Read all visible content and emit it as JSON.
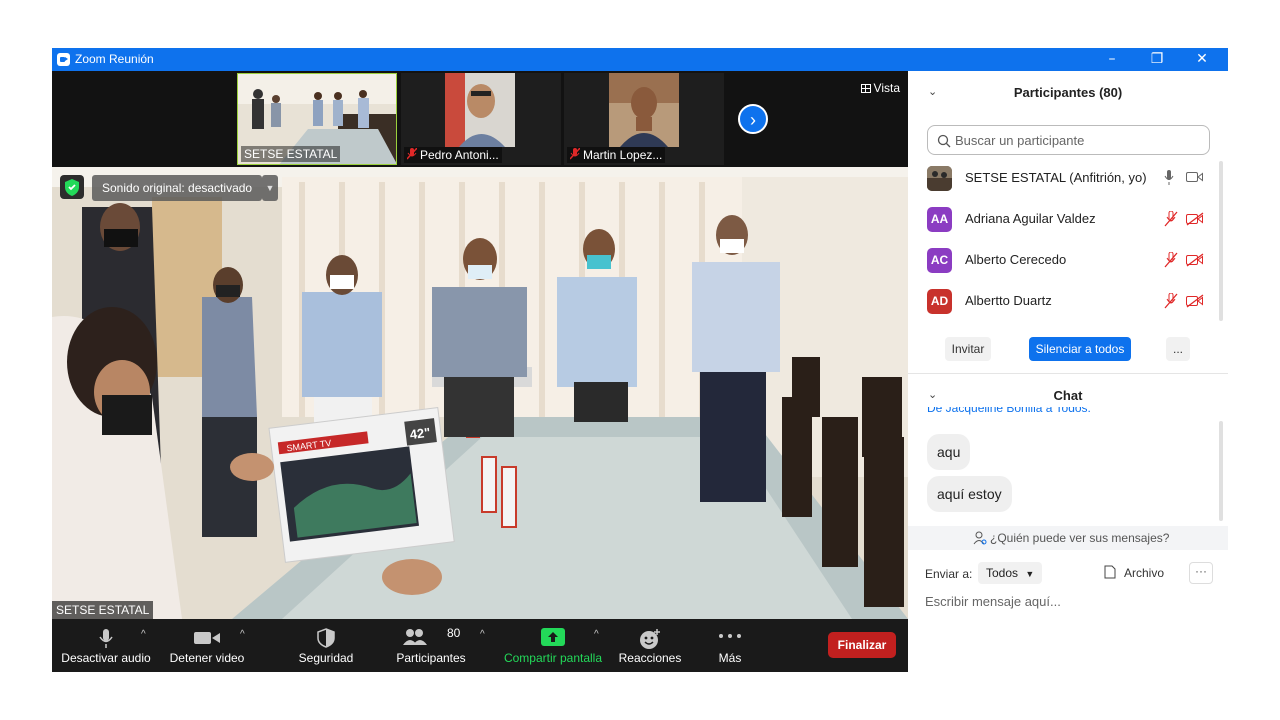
{
  "window": {
    "title": "Zoom Reunión",
    "controls": [
      "–",
      "❐",
      "✕"
    ]
  },
  "strip": {
    "thumbs": [
      {
        "label": "SETSE ESTATAL",
        "muted": false
      },
      {
        "label": "Pedro Antoni...",
        "muted": true
      },
      {
        "label": "Martin Lopez...",
        "muted": true
      }
    ],
    "next_arrow": "›",
    "view_label": "Vista"
  },
  "video": {
    "sound_label": "Sonido original: desactivado",
    "speaker_label": "SETSE ESTATAL",
    "box_text": "SMART TV",
    "box_size": "42\""
  },
  "toolbar": {
    "audio": "Desactivar audio",
    "video": "Detener video",
    "security": "Seguridad",
    "participants": "Participantes",
    "participants_count": "80",
    "share": "Compartir pantalla",
    "reactions": "Reacciones",
    "more": "Más",
    "end": "Finalizar"
  },
  "participants": {
    "title": "Participantes (80)",
    "search_placeholder": "Buscar un participante",
    "list": [
      {
        "name": "SETSE ESTATAL (Anfitrión, yo)",
        "initials": "",
        "color": "#5b4a3a",
        "muted": false
      },
      {
        "name": "Adriana Aguilar Valdez",
        "initials": "AA",
        "color": "#8b3cc2",
        "muted": true
      },
      {
        "name": "Alberto Cerecedo",
        "initials": "AC",
        "color": "#8b3cc2",
        "muted": true
      },
      {
        "name": "Albertto Duartz",
        "initials": "AD",
        "color": "#c8322c",
        "muted": true
      }
    ],
    "invite": "Invitar",
    "mute_all": "Silenciar a todos",
    "more": "..."
  },
  "chat": {
    "title": "Chat",
    "partial_header": "De Jacqueline Bonilla a Todos:",
    "messages": [
      "aqu",
      "aquí estoy"
    ],
    "who_can_see": "¿Quién puede ver sus mensajes?",
    "send_to_label": "Enviar a:",
    "send_to_value": "Todos",
    "file_label": "Archivo",
    "input_placeholder": "Escribir mensaje aquí..."
  },
  "colors": {
    "accent": "#0e72ed",
    "end_red": "#c2201f",
    "share_green": "#23d959",
    "muted_red": "#e02828"
  }
}
